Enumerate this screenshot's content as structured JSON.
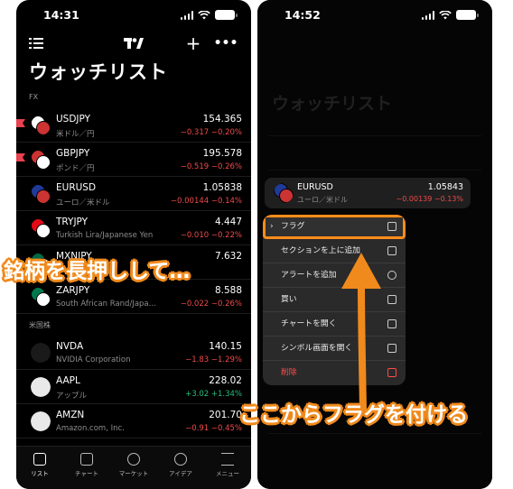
{
  "left": {
    "status": {
      "time": "14:31"
    },
    "title": "ウォッチリスト",
    "sections": {
      "fx": "FX",
      "us": "米国株"
    },
    "rows": [
      {
        "symbol": "USDJPY",
        "desc": "米ドル／円",
        "price": "154.365",
        "change": "−0.317 −0.20%",
        "dir": "neg",
        "flagged": true
      },
      {
        "symbol": "GBPJPY",
        "desc": "ポンド／円",
        "price": "195.578",
        "change": "−0.519 −0.26%",
        "dir": "neg",
        "flagged": true
      },
      {
        "symbol": "EURUSD",
        "desc": "ユーロ／米ドル",
        "price": "1.05838",
        "change": "−0.00144 −0.14%",
        "dir": "neg",
        "flagged": false
      },
      {
        "symbol": "TRYJPY",
        "desc": "Turkish Lira/Japanese Yen",
        "price": "4.447",
        "change": "−0.010 −0.22%",
        "dir": "neg",
        "flagged": false
      },
      {
        "symbol": "MXNJPY",
        "desc": "",
        "price": "7.632",
        "change": "",
        "dir": "neg",
        "flagged": false
      },
      {
        "symbol": "ZARJPY",
        "desc": "South African Rand/Japa...",
        "price": "8.588",
        "change": "−0.022 −0.26%",
        "dir": "neg",
        "flagged": false
      },
      {
        "symbol": "NVDA",
        "desc": "NVIDIA Corporation",
        "price": "140.15",
        "change": "−1.83 −1.29%",
        "dir": "neg",
        "flagged": false
      },
      {
        "symbol": "AAPL",
        "desc": "アップル",
        "price": "228.02",
        "change": "+3.02 +1.34%",
        "dir": "pos",
        "flagged": false
      },
      {
        "symbol": "AMZN",
        "desc": "Amazon.com, Inc.",
        "price": "201.70",
        "change": "−0.91 −0.45%",
        "dir": "neg",
        "flagged": false
      }
    ],
    "tabs": [
      "リスト",
      "チャート",
      "マーケット",
      "アイデア",
      "メニュー"
    ]
  },
  "right": {
    "status": {
      "time": "14:52"
    },
    "ghost_title": "ウォッチリスト",
    "card": {
      "symbol": "EURUSD",
      "desc": "ユーロ／米ドル",
      "price": "1.05843",
      "change": "−0.00139 −0.13%"
    },
    "menu": [
      {
        "label": "フラグ",
        "icon": "flag-icon"
      },
      {
        "label": "セクションを上に追加",
        "icon": "section-icon"
      },
      {
        "label": "アラートを追加",
        "icon": "alarm-icon"
      },
      {
        "label": "買い",
        "icon": "buy-icon"
      },
      {
        "label": "チャートを開く",
        "icon": "chart-icon"
      },
      {
        "label": "シンボル画面を開く",
        "icon": "symbol-icon"
      },
      {
        "label": "削除",
        "icon": "trash-icon"
      }
    ]
  },
  "captions": {
    "left": "銘柄を長押しして…",
    "right": "ここからフラグを付ける"
  },
  "colors": {
    "accent": "#f08a1c",
    "negative": "#f04a4a",
    "positive": "#27c07b"
  }
}
